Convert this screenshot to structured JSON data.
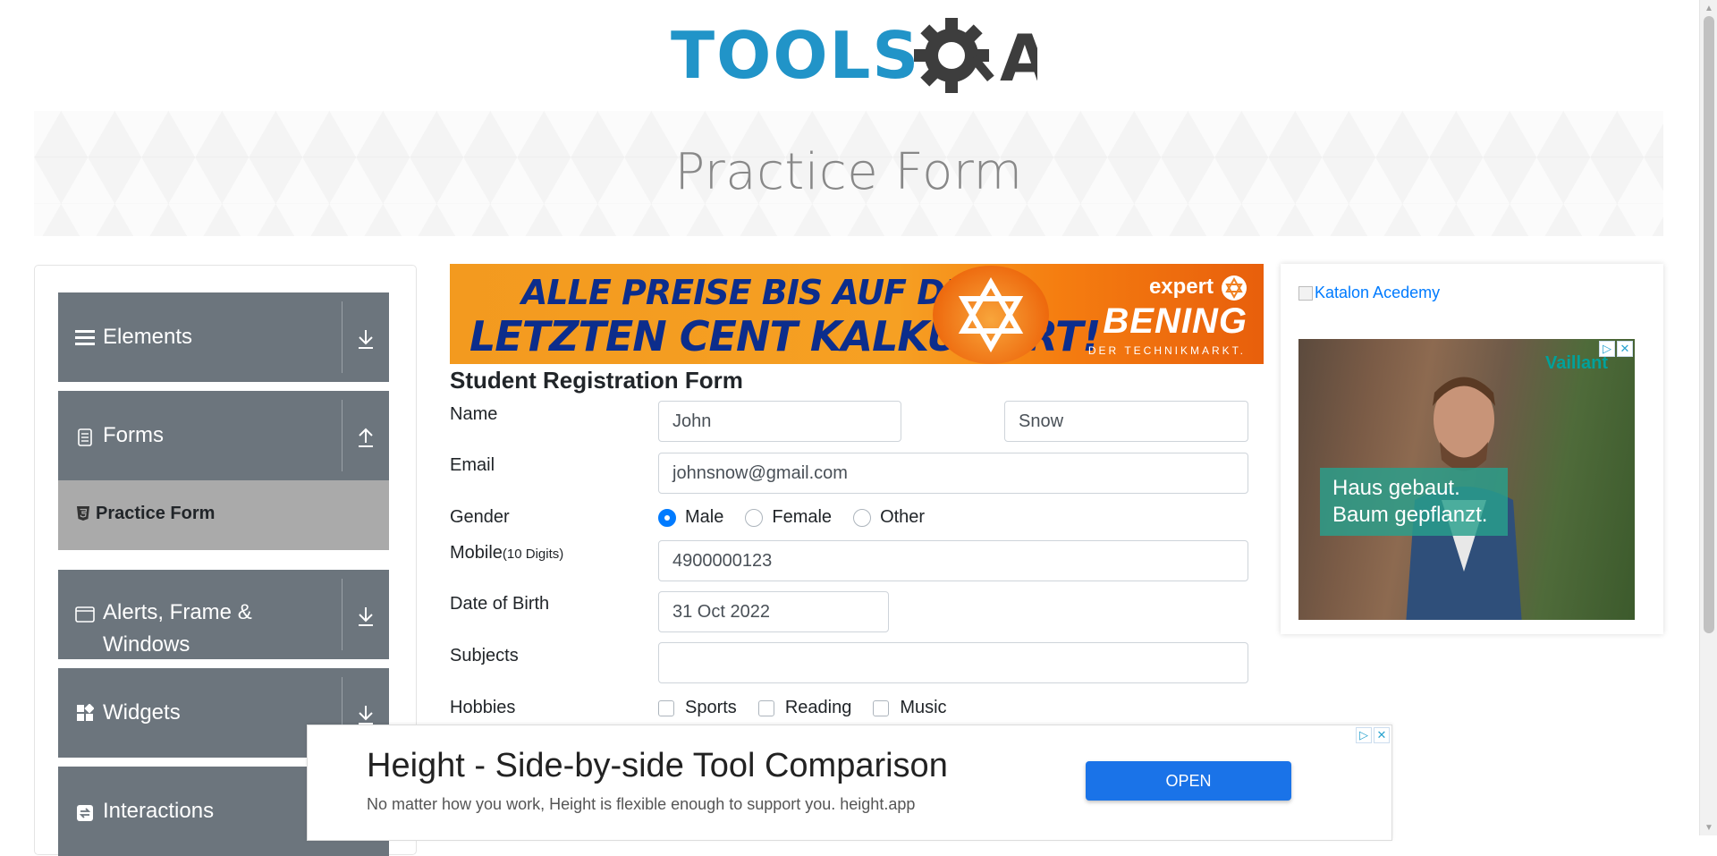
{
  "logo": {
    "text": "TOOLS",
    "suffix": "A"
  },
  "banner": {
    "title": "Practice Form"
  },
  "sidebar": {
    "groups": [
      {
        "label": "Elements",
        "icon": "hamburger-icon",
        "expanded": false
      },
      {
        "label": "Forms",
        "icon": "document-icon",
        "expanded": true
      },
      {
        "label": "Alerts, Frame &",
        "label2": "Windows",
        "icon": "window-icon",
        "expanded": false
      },
      {
        "label": "Widgets",
        "icon": "widgets-icon",
        "expanded": false
      },
      {
        "label": "Interactions",
        "icon": "interactions-icon",
        "expanded": false
      }
    ],
    "active_item": "Practice Form"
  },
  "top_ad": {
    "line1": "ALLE PREISE BIS AUF DEN",
    "line2": "LETZTEN CENT KALKULIERT!",
    "brand1": "expert",
    "brand2": "BENING",
    "brand3": "DER TECHNIKMARKT."
  },
  "form": {
    "title": "Student Registration Form",
    "labels": {
      "name": "Name",
      "email": "Email",
      "gender": "Gender",
      "mobile": "Mobile",
      "mobile_hint": "(10 Digits)",
      "dob": "Date of Birth",
      "subjects": "Subjects",
      "hobbies": "Hobbies"
    },
    "first_name": "John",
    "last_name": "Snow",
    "email": "johnsnow@gmail.com",
    "gender_options": [
      "Male",
      "Female",
      "Other"
    ],
    "gender_selected": "Male",
    "mobile": "4900000123",
    "dob": "31 Oct 2022",
    "subjects": "",
    "hobbies": [
      "Sports",
      "Reading",
      "Music"
    ]
  },
  "right_ad": {
    "link_text": "Katalon Acedemy",
    "brand": "Vaillant",
    "slogan1": "Haus gebaut.",
    "slogan2": "Baum gepflanzt."
  },
  "bottom_ad": {
    "title": "Height - Side-by-side Tool Comparison",
    "subtitle": "No matter how you work, Height is flexible enough to support you. height.app",
    "button": "OPEN"
  },
  "colors": {
    "sidebar_group": "#6c757d",
    "active_item": "#aaaaaa",
    "logo_blue": "#2194c8",
    "accent": "#007bff"
  }
}
